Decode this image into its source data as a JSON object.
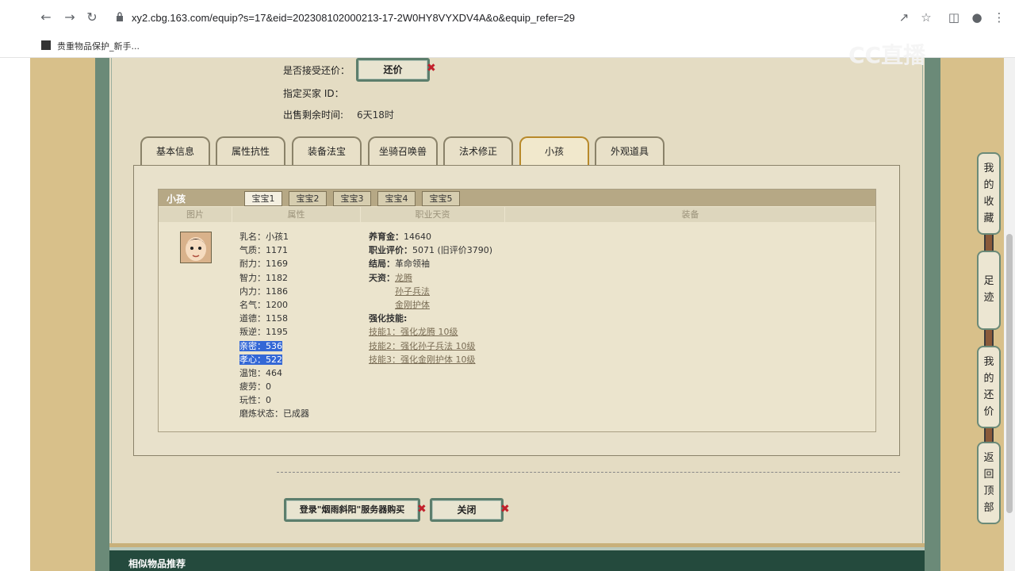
{
  "browser": {
    "url": "xy2.cbg.163.com/equip?s=17&eid=202308102000213-17-2W0HY8VYXDV4A&o&equip_refer=29",
    "bookmark": "贵重物品保护_新手..."
  },
  "watermark": "CC直播",
  "trade": {
    "accept_counter_label": "是否接受还价：",
    "counter_button": "还价",
    "buyer_id_label": "指定买家 ID：",
    "remaining_label": "出售剩余时间:",
    "remaining_value": "6天18时"
  },
  "tabs": [
    "基本信息",
    "属性抗性",
    "装备法宝",
    "坐骑召唤兽",
    "法术修正",
    "小孩",
    "外观道具"
  ],
  "active_tab": "小孩",
  "child_panel": {
    "title": "小孩",
    "subtabs": [
      "宝宝1",
      "宝宝2",
      "宝宝3",
      "宝宝4",
      "宝宝5"
    ],
    "columns": [
      "图片",
      "属性",
      "职业天资",
      "装备"
    ],
    "attributes": [
      {
        "label": "乳名：",
        "value": "小孩1"
      },
      {
        "label": "气质：",
        "value": "1171"
      },
      {
        "label": "耐力：",
        "value": "1169"
      },
      {
        "label": "智力：",
        "value": "1182"
      },
      {
        "label": "内力：",
        "value": "1186"
      },
      {
        "label": "名气：",
        "value": "1200"
      },
      {
        "label": "道德：",
        "value": "1158"
      },
      {
        "label": "叛逆：",
        "value": "1195"
      },
      {
        "label": "亲密：",
        "value": "536"
      },
      {
        "label": "孝心：",
        "value": "522"
      },
      {
        "label": "温饱：",
        "value": "464"
      },
      {
        "label": "疲劳：",
        "value": "0"
      },
      {
        "label": "玩性：",
        "value": "0"
      },
      {
        "label": "磨炼状态：",
        "value": "已成器"
      }
    ],
    "career": {
      "money_label": "养育金：",
      "money_value": "14640",
      "rating_label": "职业评价：",
      "rating_value": "5071 (旧评价3790)",
      "ending_label": "结局：",
      "ending_value": "革命领袖",
      "talent_label": "天资：",
      "talents": [
        "龙腾",
        "孙子兵法",
        "金刚护体"
      ],
      "skills_label": "强化技能:",
      "skills": [
        "技能1：强化龙腾 10级",
        "技能2：强化孙子兵法 10级",
        "技能3：强化金刚护体 10级"
      ]
    }
  },
  "actions": {
    "buy_button": "登录\"烟雨斜阳\"服务器购买",
    "close_button": "关闭"
  },
  "sidebar": {
    "favorites": "我的收藏",
    "footprints": "足迹",
    "counter": "我的还价",
    "top": "返回顶部"
  },
  "recommend_title": "相似物品推荐"
}
